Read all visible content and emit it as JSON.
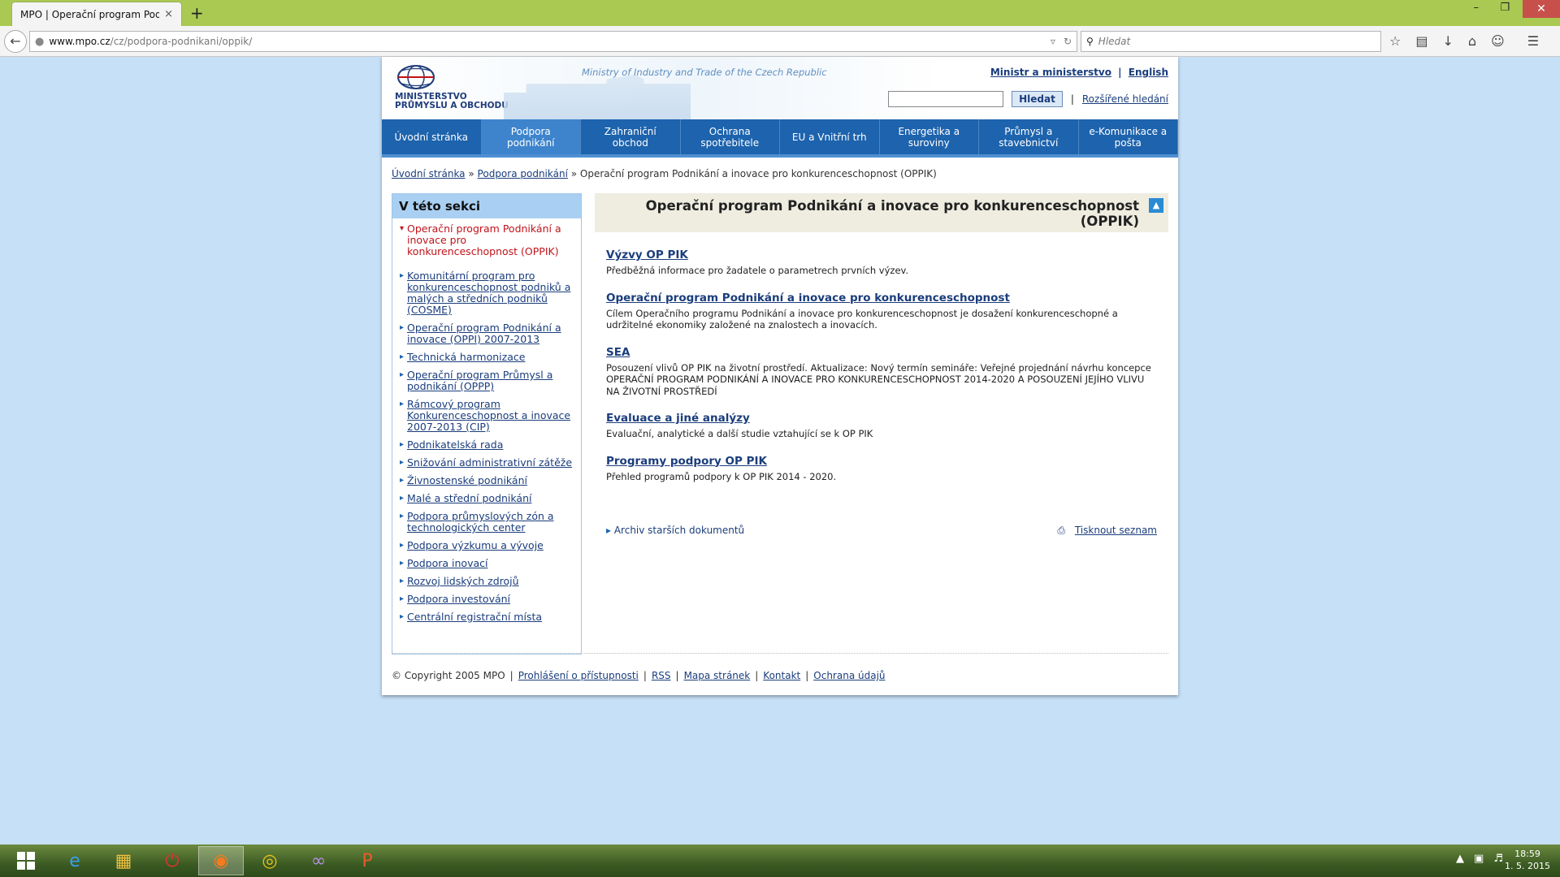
{
  "browser": {
    "tab_title": "MPO | Operační program Podn...",
    "tab_close": "×",
    "new_tab": "+",
    "url_host": "www.mpo.cz",
    "url_path": "/cz/podpora-podnikani/oppik/",
    "search_placeholder": "Hledat"
  },
  "header": {
    "logo_line1": "MINISTERSTVO",
    "logo_line2": "PRŮMYSLU A OBCHODU",
    "ministry_en": "Ministry of Industry and Trade of the Czech Republic",
    "link_ministr": "Ministr a ministerstvo",
    "link_english": "English",
    "search_button": "Hledat",
    "advanced_search": "Rozšířené hledání"
  },
  "menu": [
    {
      "label": "Úvodní stránka"
    },
    {
      "label": "Podpora podnikání"
    },
    {
      "label": "Zahraniční obchod"
    },
    {
      "label": "Ochrana spotřebitele"
    },
    {
      "label": "EU a Vnitřní trh"
    },
    {
      "label": "Energetika a suroviny"
    },
    {
      "label": "Průmysl a stavebnictví"
    },
    {
      "label": "e-Komunikace a pošta"
    }
  ],
  "breadcrumb": {
    "home": "Úvodní stránka",
    "section": "Podpora podnikání",
    "current": "Operační program Podnikání a inovace pro konkurenceschopnost (OPPIK)",
    "separator": "»"
  },
  "sidebar": {
    "heading": "V této sekci",
    "items": [
      {
        "label": "Operační program Podnikání a inovace pro konkurenceschopnost (OPPIK)"
      },
      {
        "label": "Komunitární program pro konkurenceschopnost podniků a malých a středních podniků (COSME)"
      },
      {
        "label": "Operační program Podnikání a inovace (OPPI) 2007-2013"
      },
      {
        "label": "Technická harmonizace"
      },
      {
        "label": "Operační program Průmysl a podnikání (OPPP)"
      },
      {
        "label": "Rámcový program Konkurenceschopnost a inovace 2007-2013 (CIP)"
      },
      {
        "label": "Podnikatelská rada"
      },
      {
        "label": "Snižování administrativní zátěže"
      },
      {
        "label": "Živnostenské podnikání"
      },
      {
        "label": "Malé a střední podnikání"
      },
      {
        "label": "Podpora průmyslových zón a technologických center"
      },
      {
        "label": "Podpora výzkumu a vývoje"
      },
      {
        "label": "Podpora inovací"
      },
      {
        "label": "Rozvoj lidských zdrojů"
      },
      {
        "label": "Podpora investování"
      },
      {
        "label": "Centrální registrační místa"
      }
    ]
  },
  "content": {
    "title": "Operační program Podnikání a inovace pro konkurenceschopnost (OPPIK)",
    "entries": [
      {
        "title": "Výzvy OP PIK",
        "desc": "Předběžná informace pro žadatele o parametrech prvních výzev."
      },
      {
        "title": "Operační program Podnikání a inovace pro konkurenceschopnost",
        "desc": "Cílem Operačního programu Podnikání a inovace pro konkurenceschopnost je dosažení konkurenceschopné a udržitelné ekonomiky založené na znalostech a inovacích."
      },
      {
        "title": "SEA",
        "desc": "Posouzení vlivů OP PIK na životní prostředí. Aktualizace: Nový termín semináře: Veřejné projednání návrhu koncepce OPERAČNÍ PROGRAM PODNIKÁNÍ A INOVACE PRO KONKURENCESCHOPNOST 2014-2020 A POSOUZENÍ JEJÍHO VLIVU NA ŽIVOTNÍ PROSTŘEDÍ"
      },
      {
        "title": "Evaluace a jiné analýzy",
        "desc": "Evaluační, analytické a další studie vztahující se k OP PIK"
      },
      {
        "title": "Programy podpory OP PIK",
        "desc": "Přehled programů podpory k OP PIK 2014 - 2020."
      }
    ],
    "archive": "Archiv starších dokumentů",
    "print": "Tisknout seznam"
  },
  "footer": {
    "copyright": "© Copyright 2005 MPO",
    "links": [
      "Prohlášení o přístupnosti",
      "RSS",
      "Mapa stránek",
      "Kontakt",
      "Ochrana údajů"
    ]
  },
  "taskbar": {
    "time": "18:59",
    "date": "1. 5. 2015"
  },
  "colors": {
    "menu_bg": "#1d63ad",
    "link": "#1a3d7c",
    "current_item": "#c0131a",
    "page_bg": "#c6e0f7"
  }
}
